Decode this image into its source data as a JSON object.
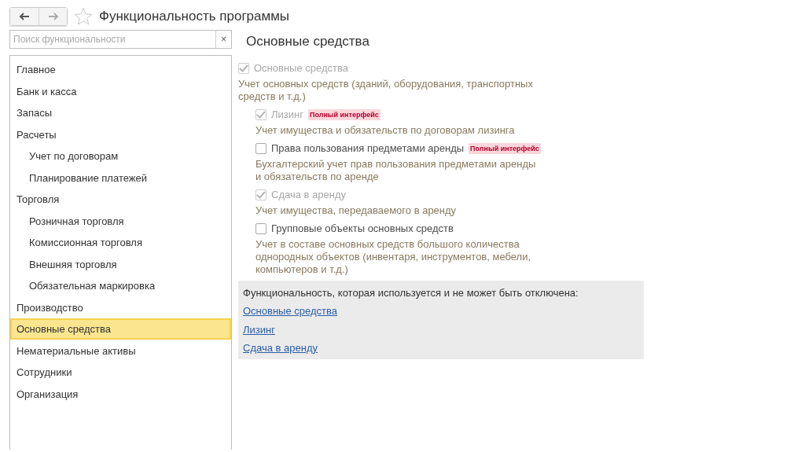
{
  "window": {
    "title": "Функциональность программы",
    "favorite": false
  },
  "search": {
    "placeholder": "Поиск функциональности",
    "clear": "×"
  },
  "sidebar": {
    "items": [
      {
        "label": "Главное",
        "selected": false
      },
      {
        "label": "Банк и касса",
        "selected": false
      },
      {
        "label": "Запасы",
        "selected": false
      },
      {
        "label": "Расчеты",
        "selected": false,
        "children": [
          {
            "label": "Учет по договорам",
            "selected": false
          },
          {
            "label": "Планирование платежей",
            "selected": false
          }
        ]
      },
      {
        "label": "Торговля",
        "selected": false,
        "children": [
          {
            "label": "Розничная торговля",
            "selected": false
          },
          {
            "label": "Комиссионная торговля",
            "selected": false
          },
          {
            "label": "Внешняя торговля",
            "selected": false
          },
          {
            "label": "Обязательная маркировка",
            "selected": false
          }
        ]
      },
      {
        "label": "Производство",
        "selected": false
      },
      {
        "label": "Основные средства",
        "selected": true
      },
      {
        "label": "Нематериальные активы",
        "selected": false
      },
      {
        "label": "Сотрудники",
        "selected": false
      },
      {
        "label": "Организация",
        "selected": false
      }
    ]
  },
  "section": {
    "title": "Основные средства",
    "options": [
      {
        "label": "Основные средства",
        "checked": true,
        "disabled": true,
        "description": "Учет основных средств (зданий, оборудования, транспортных средств и т.д.)",
        "children": [
          {
            "label": "Лизинг",
            "badge": "Полный интерфейс",
            "checked": true,
            "disabled": true,
            "description": "Учет имущества и обязательств  по договорам лизинга"
          },
          {
            "label": "Права пользования предметами аренды",
            "badge": "Полный интерфейс",
            "checked": false,
            "disabled": false,
            "description": "Бухгалтерский учет прав пользования предметами аренды\nи обязательств по аренде"
          },
          {
            "label": "Сдача в аренду",
            "checked": true,
            "disabled": true,
            "description": "Учет имущества, передаваемого в аренду"
          },
          {
            "label": "Групповые объекты основных средств",
            "checked": false,
            "disabled": false,
            "description": "Учет в составе основных средств большого количества\nоднородных объектов (инвентаря, инструментов, мебели,\nкомпьютеров и т.д.)"
          }
        ]
      }
    ],
    "locked": {
      "caption": "Функциональность, которая используется и не может быть отключена:",
      "links": [
        "Основные средства",
        "Лизинг",
        "Сдача в аренду"
      ]
    }
  }
}
